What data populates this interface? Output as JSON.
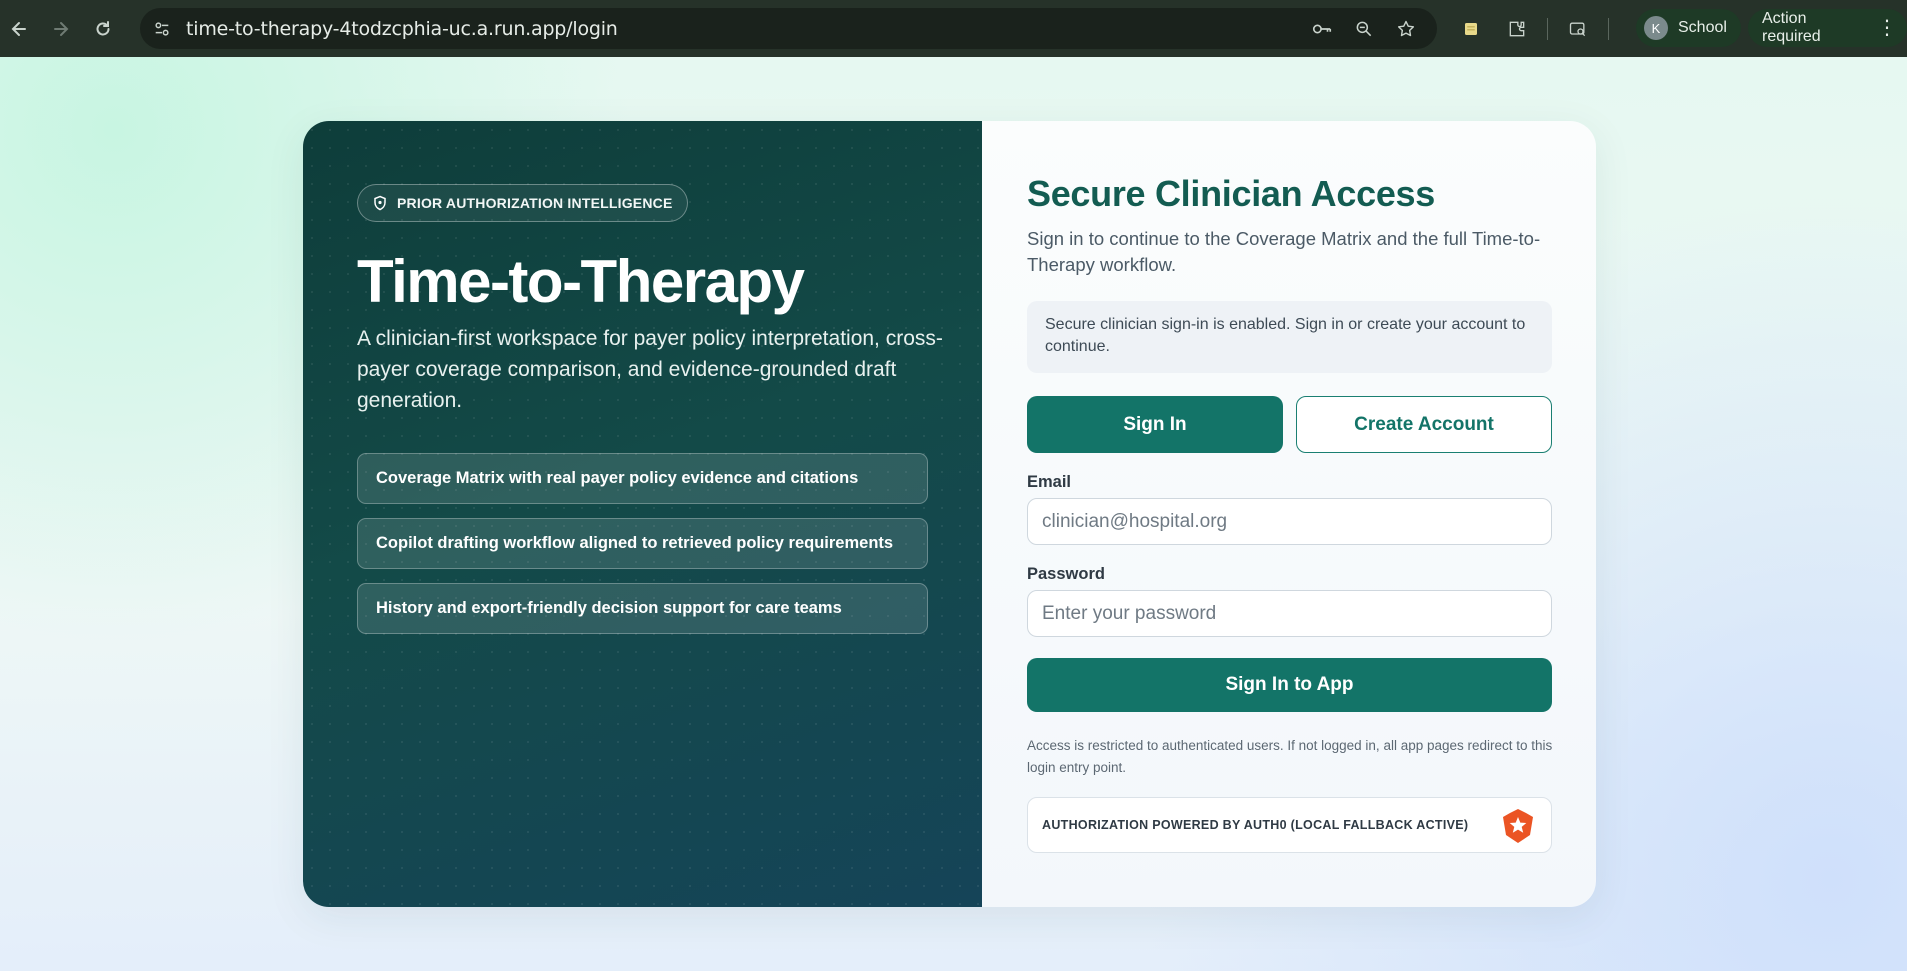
{
  "browser": {
    "url": "time-to-therapy-4todzcphia-uc.a.run.app/login",
    "profile_initial": "K",
    "profile_label": "School",
    "action_label": "Action required"
  },
  "hero": {
    "badge": "PRIOR AUTHORIZATION INTELLIGENCE",
    "title": "Time-to-Therapy",
    "description": "A clinician-first workspace for payer policy interpretation, cross-payer coverage comparison, and evidence-grounded draft generation.",
    "features": [
      "Coverage Matrix with real payer policy evidence and citations",
      "Copilot drafting workflow aligned to retrieved policy requirements",
      "History and export-friendly decision support for care teams"
    ]
  },
  "login": {
    "title": "Secure Clinician Access",
    "subtitle": "Sign in to continue to the Coverage Matrix and the full Time-to-Therapy workflow.",
    "notice": "Secure clinician sign-in is enabled. Sign in or create your account to continue.",
    "tab_sign_in": "Sign In",
    "tab_create": "Create Account",
    "email_label": "Email",
    "email_placeholder": "clinician@hospital.org",
    "password_label": "Password",
    "password_placeholder": "Enter your password",
    "submit_label": "Sign In to App",
    "fine_print": "Access is restricted to authenticated users. If not logged in, all app pages redirect to this login entry point.",
    "auth_provider": "AUTHORIZATION POWERED BY AUTH0 (LOCAL FALLBACK ACTIVE)"
  },
  "colors": {
    "brand": "#137468",
    "panel_dark": "#0e3d3a",
    "auth0": "#eb5424"
  }
}
